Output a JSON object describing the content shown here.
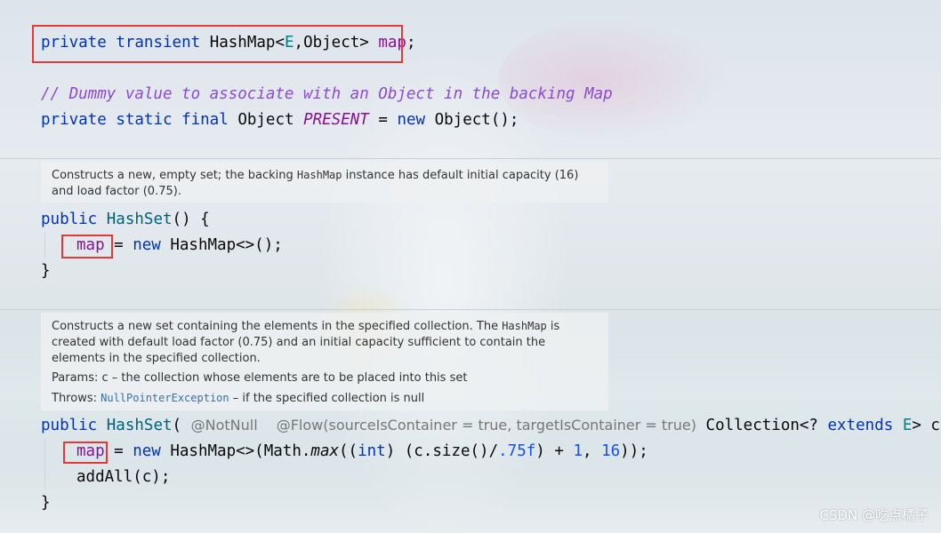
{
  "code": {
    "l1": {
      "private": "private",
      "transient": "transient",
      "type": "HashMap<",
      "generic": "E",
      "rest": ",Object> ",
      "field": "map",
      "end": ";"
    },
    "comment": "// Dummy value to associate with an Object in the backing Map",
    "l3": {
      "private": "private",
      "static": "static",
      "final": "final",
      "type": "Object ",
      "field": "PRESENT",
      "eq": " = ",
      "new": "new",
      "rest": " Object();"
    },
    "ctor1": {
      "public": "public",
      "name": "HashSet",
      "rest": "() {"
    },
    "ctor1_body": {
      "field": "map",
      "eq": " = ",
      "new": "new",
      "rest": " HashMap<>();"
    },
    "close": "}",
    "ctor2": {
      "public": "public",
      "name": "HashSet",
      "paren": "( ",
      "anno1": "@NotNull",
      "anno2": "@Flow(sourceIsContainer = true, targetIsContainer = true)",
      "type": " Collection<? ",
      "extends": "extends",
      "generic": " E",
      "rest": "> c) {"
    },
    "ctor2_body1": {
      "field": "map",
      "eq": " = ",
      "new": "new",
      "t1": " HashMap<>(Math.",
      "max": "max",
      "t2": "((",
      "int": "int",
      "t3": ") (c.size()/",
      "f": ".75f",
      "t4": ") + ",
      "one": "1",
      "t5": ", ",
      "sixteen": "16",
      "t6": "));"
    },
    "ctor2_body2": "addAll(c);"
  },
  "doc1": {
    "text_a": "Constructs a new, empty set; the backing ",
    "code": "HashMap",
    "text_b": " instance has default initial capacity (16) and load factor (0.75)."
  },
  "doc2": {
    "text_a": "Constructs a new set containing the elements in the specified collection. The ",
    "code": "HashMap",
    "text_b": " is created with default load factor (0.75) and an initial capacity sufficient to contain the elements in the specified collection.",
    "params": "Params: c – the collection whose elements are to be placed into this set",
    "throws_label": "Throws: ",
    "throws_link": "NullPointerException",
    "throws_text": " – if the specified collection is null"
  },
  "watermark": "CSDN @吃点橘子",
  "colors": {
    "highlight": "#e53935",
    "keyword": "#0033b3",
    "field": "#871094",
    "comment": "#8c49d4"
  }
}
